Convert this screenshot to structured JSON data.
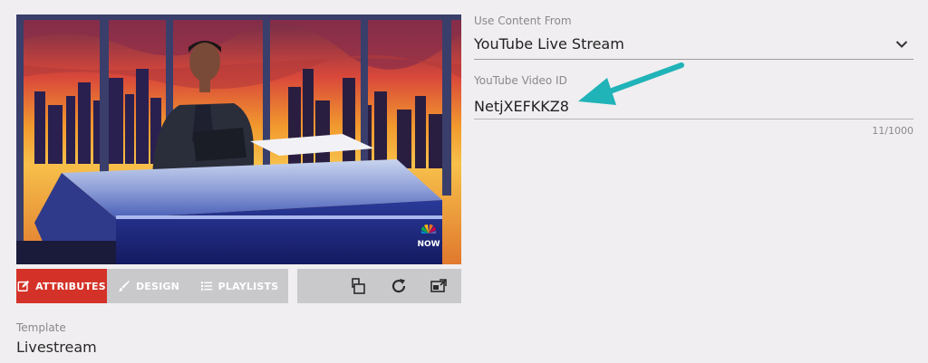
{
  "preview": {
    "network_logo": "NOW"
  },
  "tabs": [
    {
      "label": "ATTRIBUTES",
      "icon": "edit-icon",
      "active": true
    },
    {
      "label": "DESIGN",
      "icon": "brush-icon",
      "active": false
    },
    {
      "label": "PLAYLISTS",
      "icon": "list-icon",
      "active": false
    }
  ],
  "toolbar": {
    "icons": [
      "layout-icon",
      "refresh-icon",
      "expand-icon"
    ]
  },
  "template": {
    "label": "Template",
    "value": "Livestream"
  },
  "form": {
    "content_label": "Use Content From",
    "content_value": "YouTube Live Stream",
    "video_label": "YouTube Video ID",
    "video_value": "NetjXEFKKZ8",
    "counter": "11/1000"
  },
  "colors": {
    "accent": "#d43228",
    "tab_inactive": "#c9c8cb",
    "annotation_arrow": "#20b3b8"
  }
}
